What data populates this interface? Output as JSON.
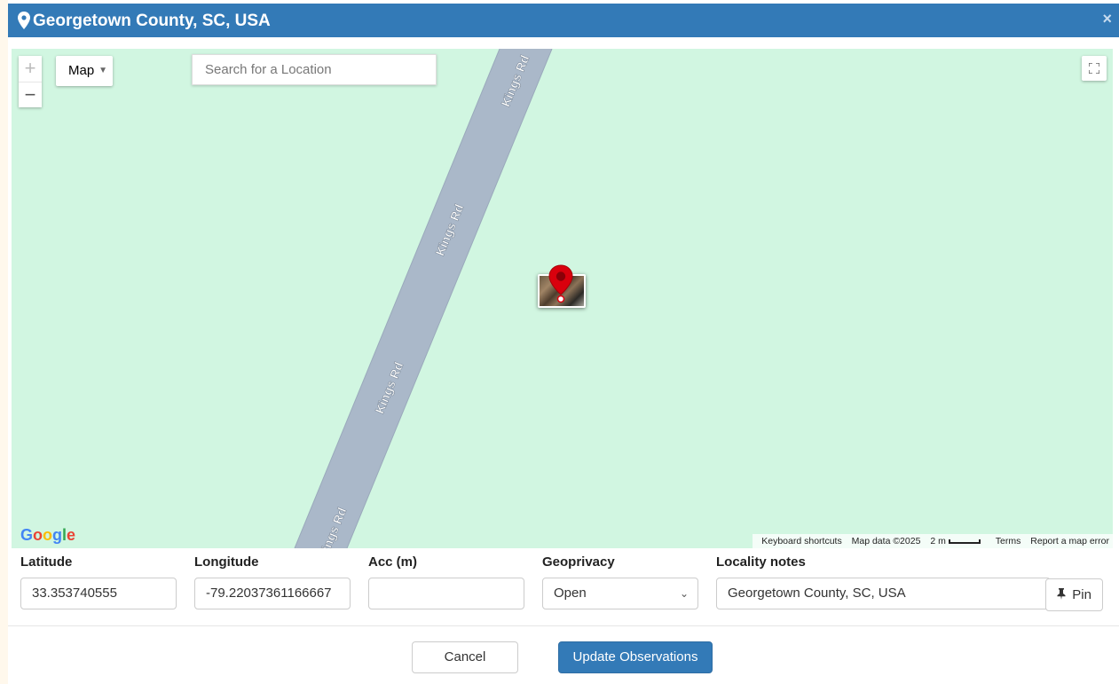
{
  "header": {
    "title": "Georgetown County, SC, USA",
    "close_label": "×",
    "bg_color": "#337ab7"
  },
  "map": {
    "type_label": "Map",
    "zoom_in": "+",
    "zoom_out": "−",
    "search_placeholder": "Search for a Location",
    "road_label": "Kings Rd",
    "logo": "Google",
    "attribution": {
      "shortcuts": "Keyboard shortcuts",
      "map_data": "Map data ©2025",
      "scale": "2 m",
      "terms": "Terms",
      "report": "Report a map error"
    },
    "background_color": "#d1f6e1",
    "road_color": "#aab8c9",
    "marker_color": "#d9000d"
  },
  "form": {
    "latitude": {
      "label": "Latitude",
      "value": "33.353740555"
    },
    "longitude": {
      "label": "Longitude",
      "value": "-79.22037361166667"
    },
    "accuracy": {
      "label": "Acc (m)",
      "value": ""
    },
    "geoprivacy": {
      "label": "Geoprivacy",
      "value": "Open"
    },
    "locality": {
      "label": "Locality notes",
      "value": "Georgetown County, SC, USA"
    },
    "pin_label": "Pin"
  },
  "actions": {
    "cancel": "Cancel",
    "update": "Update Observations"
  }
}
